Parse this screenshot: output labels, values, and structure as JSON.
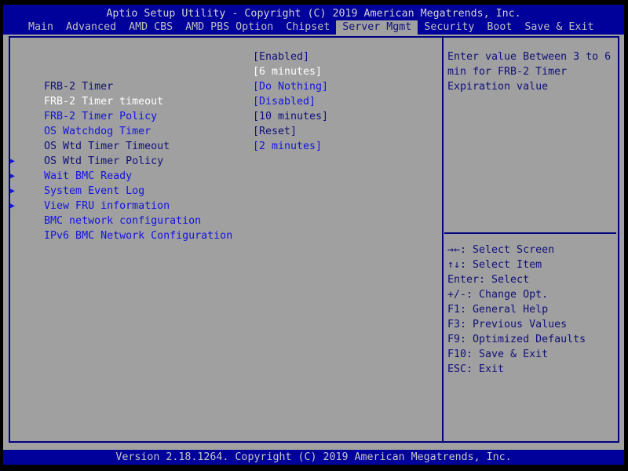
{
  "window": {
    "title": "Aptio Setup Utility - Copyright (C) 2019 American Megatrends, Inc."
  },
  "menu_bar": {
    "items": [
      {
        "label": "Main",
        "selected": false
      },
      {
        "label": "Advanced",
        "selected": false
      },
      {
        "label": "AMD CBS",
        "selected": false
      },
      {
        "label": "AMD PBS Option",
        "selected": false
      },
      {
        "label": "Chipset",
        "selected": false
      },
      {
        "label": "Server Mgmt",
        "selected": true
      },
      {
        "label": "Security",
        "selected": false
      },
      {
        "label": "Boot",
        "selected": false
      },
      {
        "label": "Save & Exit",
        "selected": false
      }
    ]
  },
  "settings_pane": {
    "rows": [
      {
        "label": "FRB-2 Timer",
        "value": "[Enabled]",
        "state": "dim",
        "submenu": false
      },
      {
        "label": "FRB-2 Timer timeout",
        "value": "[6 minutes]",
        "state": "selected",
        "submenu": false
      },
      {
        "label": "FRB-2 Timer Policy",
        "value": "[Do Nothing]",
        "state": "active",
        "submenu": false
      },
      {
        "label": "OS Watchdog Timer",
        "value": "[Disabled]",
        "state": "active",
        "submenu": false
      },
      {
        "label": "OS Wtd Timer Timeout",
        "value": "[10 minutes]",
        "state": "dim",
        "submenu": false
      },
      {
        "label": "OS Wtd Timer Policy",
        "value": "[Reset]",
        "state": "dim",
        "submenu": false
      },
      {
        "label": "Wait BMC Ready",
        "value": "[2 minutes]",
        "state": "active",
        "submenu": false
      },
      {
        "label": "System Event Log",
        "value": "",
        "state": "active",
        "submenu": true
      },
      {
        "label": "View FRU information",
        "value": "",
        "state": "active",
        "submenu": true
      },
      {
        "label": "BMC network configuration",
        "value": "",
        "state": "active",
        "submenu": true
      },
      {
        "label": "IPv6 BMC Network Configuration",
        "value": "",
        "state": "active",
        "submenu": true
      }
    ],
    "submenu_arrow_icon": "▶"
  },
  "help_pane": {
    "help_lines": [
      "Enter value Between 3 to 6",
      "min for FRB-2 Timer",
      "Expiration value"
    ],
    "hotkeys": [
      {
        "keys": "→←",
        "action": "Select Screen"
      },
      {
        "keys": "↑↓",
        "action": "Select Item"
      },
      {
        "keys": "Enter",
        "action": "Select"
      },
      {
        "keys": "+/-",
        "action": "Change Opt."
      },
      {
        "keys": "F1",
        "action": "General Help"
      },
      {
        "keys": "F3",
        "action": "Previous Values"
      },
      {
        "keys": "F9",
        "action": "Optimized Defaults"
      },
      {
        "keys": "F10",
        "action": "Save & Exit"
      },
      {
        "keys": "ESC",
        "action": "Exit"
      }
    ]
  },
  "footer": {
    "version": "Version 2.18.1264. Copyright (C) 2019 American Megatrends, Inc."
  },
  "colors": {
    "screen_border": "#000000",
    "bar_blue": "#00009B",
    "panel_gray": "#A0A0A0",
    "navy_text": "#10107A",
    "active_blue_text": "#1414E0",
    "selected_white_text": "#FFFFFF",
    "bar_text_gray": "#C6C6C6",
    "border_navy": "#000080"
  }
}
